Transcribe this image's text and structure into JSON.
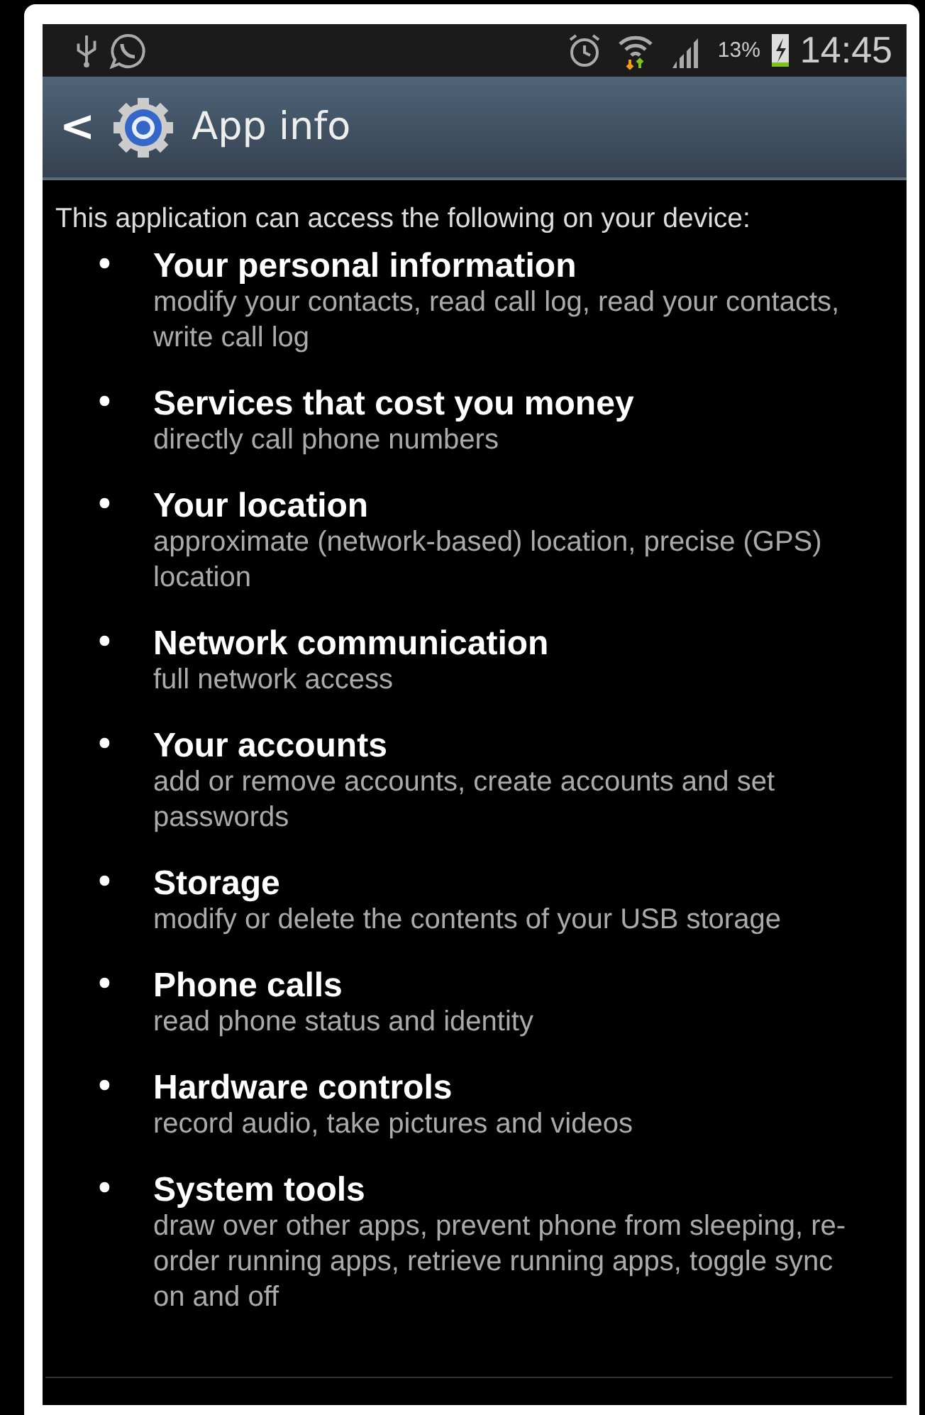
{
  "status_bar": {
    "battery": "13%",
    "time": "14:45"
  },
  "header": {
    "back": "<",
    "title": "App info"
  },
  "intro": "This application can access the following on your device:",
  "permissions": [
    {
      "bullet": "•",
      "title": "Your personal information",
      "description": "modify your contacts, read call log, read your contacts, write call log"
    },
    {
      "bullet": "•",
      "title": "Services that cost you money",
      "description": "directly call phone numbers"
    },
    {
      "bullet": "•",
      "title": "Your location",
      "description": "approximate (network-based) location, precise (GPS) location"
    },
    {
      "bullet": "•",
      "title": "Network communication",
      "description": "full network access"
    },
    {
      "bullet": "•",
      "title": "Your accounts",
      "description": "add or remove accounts, create accounts and set passwords"
    },
    {
      "bullet": "•",
      "title": "Storage",
      "description": "modify or delete the contents of your USB storage"
    },
    {
      "bullet": "•",
      "title": "Phone calls",
      "description": "read phone status and identity"
    },
    {
      "bullet": "•",
      "title": "Hardware controls",
      "description": "record audio, take pictures and videos"
    },
    {
      "bullet": "•",
      "title": "System tools",
      "description": "draw over other apps, prevent phone from sleeping, re-order running apps, retrieve running apps, toggle sync on and off"
    }
  ]
}
